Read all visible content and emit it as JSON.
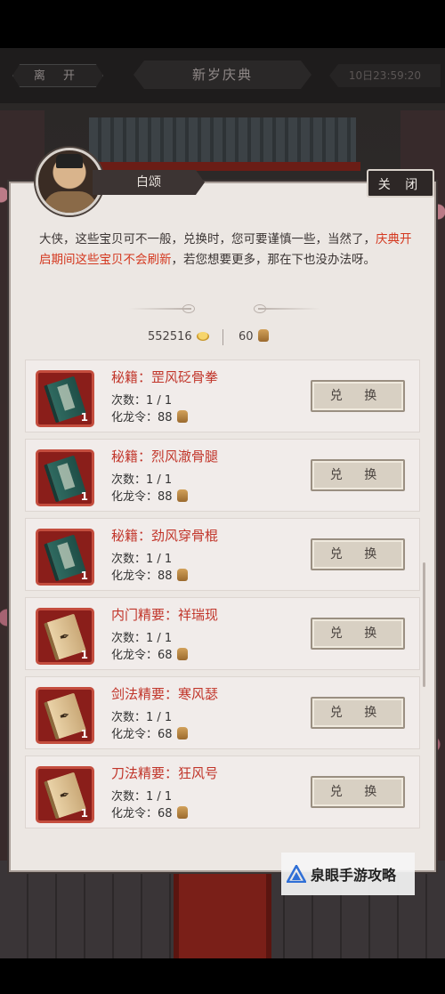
{
  "topbar": {
    "leave_label": "离 开",
    "event_title": "新岁庆典",
    "timer_text": "10日23:59:20"
  },
  "npc": {
    "name": "白颂",
    "close_label": "关 闭",
    "dialogue_part1": "大侠，这些宝贝可不一般，兑换时，您可要谨慎一些，当然了，",
    "dialogue_highlight": "庆典开启期间这些宝贝不会刷新",
    "dialogue_part2": "，若您想要更多，那在下也没办法呀。"
  },
  "currency": {
    "gold": "552516",
    "gold_icon": "gold-ingot-icon",
    "token": "60",
    "token_icon": "dragon-token-icon"
  },
  "items": [
    {
      "title": "秘籍：罡风砭骨拳",
      "count": "次数：1 / 1",
      "cost_label": "化龙令：88",
      "qty": "1",
      "book": "green",
      "button": "兑 换"
    },
    {
      "title": "秘籍：烈风澈骨腿",
      "count": "次数：1 / 1",
      "cost_label": "化龙令：88",
      "qty": "1",
      "book": "green",
      "button": "兑 换"
    },
    {
      "title": "秘籍：劲风穿骨棍",
      "count": "次数：1 / 1",
      "cost_label": "化龙令：88",
      "qty": "1",
      "book": "green",
      "button": "兑 换"
    },
    {
      "title": "内门精要：祥瑞现",
      "count": "次数：1 / 1",
      "cost_label": "化龙令：68",
      "qty": "1",
      "book": "paper",
      "button": "兑 换"
    },
    {
      "title": "剑法精要：寒风瑟",
      "count": "次数：1 / 1",
      "cost_label": "化龙令：68",
      "qty": "1",
      "book": "paper",
      "button": "兑 换"
    },
    {
      "title": "刀法精要：狂风号",
      "count": "次数：1 / 1",
      "cost_label": "化龙令：68",
      "qty": "1",
      "book": "paper",
      "button": "兑 换"
    }
  ],
  "watermark": {
    "text": "泉眼手游攻略",
    "logo_color": "#2f6fd6"
  },
  "colors": {
    "highlight": "#d4381f",
    "item_title": "#c1352a",
    "icon_frame": "#c44d3e"
  }
}
